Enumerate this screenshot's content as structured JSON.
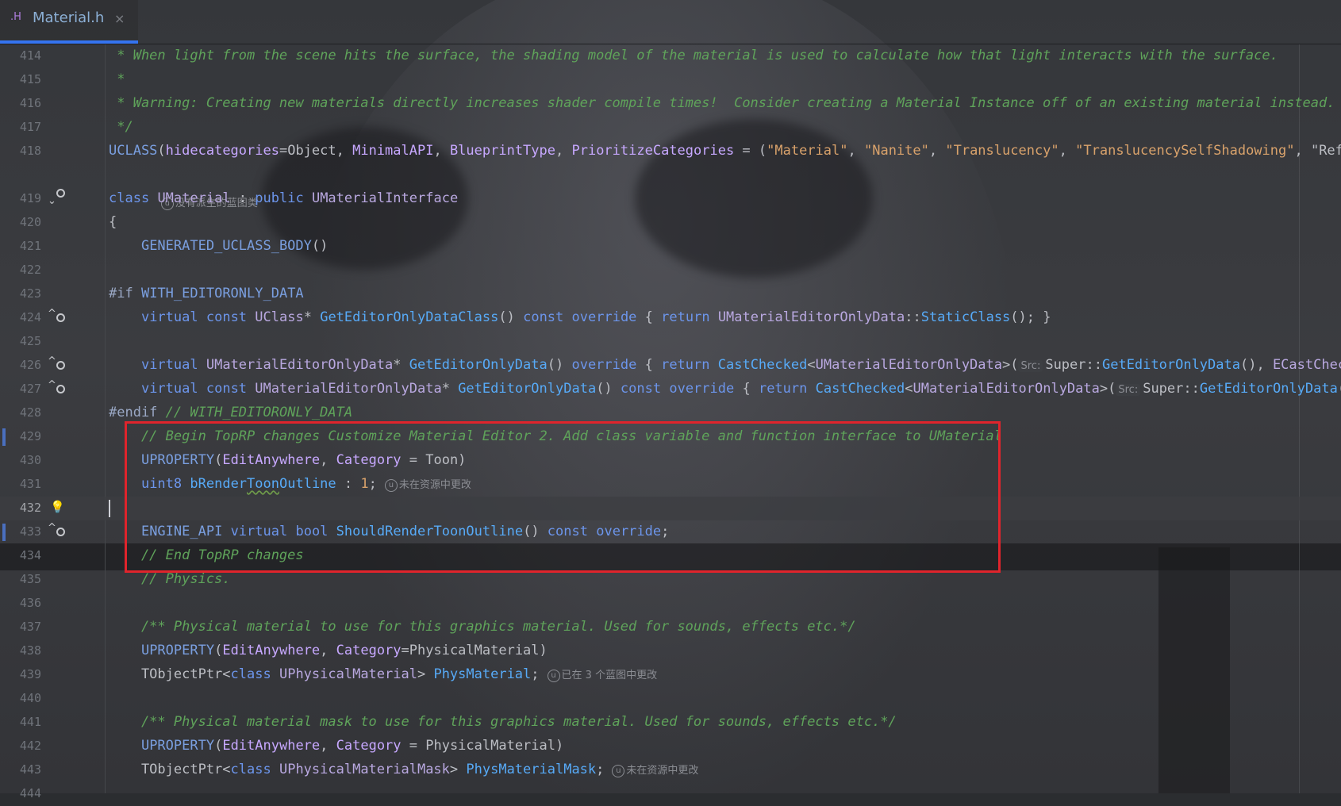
{
  "tab": {
    "icon": ".H",
    "filename": "Material.h",
    "close": "×"
  },
  "lines": [
    {
      "n": "414",
      "code": " * When light from the scene hits the surface, the shading model of the material is used to calculate how that light interacts with the surface."
    },
    {
      "n": "415",
      "code": " *"
    },
    {
      "n": "416",
      "code": " * Warning: Creating new materials directly increases shader compile times!  Consider creating a Material Instance off of an existing material instead."
    },
    {
      "n": "417",
      "code": " */"
    },
    {
      "n": "418",
      "code": "UCLASS(hidecategories=Object, MinimalAPI, BlueprintType, PrioritizeCategories = (\"Material\", \"Nanite\", \"Translucency\", \"TranslucencySelfShadowing\", \"Refract"
    },
    {
      "n": "",
      "hint": "没有派生的蓝图类"
    },
    {
      "n": "419",
      "code": "class UMaterial : public UMaterialInterface"
    },
    {
      "n": "420",
      "code": "{"
    },
    {
      "n": "421",
      "code": "    GENERATED_UCLASS_BODY()"
    },
    {
      "n": "422",
      "code": ""
    },
    {
      "n": "423",
      "code": "#if WITH_EDITORONLY_DATA"
    },
    {
      "n": "424",
      "code": "    virtual const UClass* GetEditorOnlyDataClass() const override { return UMaterialEditorOnlyData::StaticClass(); }"
    },
    {
      "n": "425",
      "code": ""
    },
    {
      "n": "426",
      "code": "    virtual UMaterialEditorOnlyData* GetEditorOnlyData() override { return CastChecked<UMaterialEditorOnlyData>(Src:Super::GetEditorOnlyData(), ECastChecked"
    },
    {
      "n": "427",
      "code": "    virtual const UMaterialEditorOnlyData* GetEditorOnlyData() const override { return CastChecked<UMaterialEditorOnlyData>(Src:Super::GetEditorOnlyData(),"
    },
    {
      "n": "428",
      "code": "#endif // WITH_EDITORONLY_DATA"
    },
    {
      "n": "429",
      "code": "    // Begin TopRP changes Customize Material Editor 2. Add class variable and function interface to UMaterial"
    },
    {
      "n": "430",
      "code": "    UPROPERTY(EditAnywhere, Category = Toon)"
    },
    {
      "n": "431",
      "code": "    uint8 bRenderToonOutline : 1;",
      "hint": "未在资源中更改"
    },
    {
      "n": "432",
      "code": ""
    },
    {
      "n": "433",
      "code": "    ENGINE_API virtual bool ShouldRenderToonOutline() const override;"
    },
    {
      "n": "434",
      "code": "    // End TopRP changes"
    },
    {
      "n": "435",
      "code": "    // Physics."
    },
    {
      "n": "436",
      "code": ""
    },
    {
      "n": "437",
      "code": "    /** Physical material to use for this graphics material. Used for sounds, effects etc.*/"
    },
    {
      "n": "438",
      "code": "    UPROPERTY(EditAnywhere, Category=PhysicalMaterial)"
    },
    {
      "n": "439",
      "code": "    TObjectPtr<class UPhysicalMaterial> PhysMaterial;",
      "hint": "已在 3 个蓝图中更改"
    },
    {
      "n": "440",
      "code": ""
    },
    {
      "n": "441",
      "code": "    /** Physical material mask to use for this graphics material. Used for sounds, effects etc.*/"
    },
    {
      "n": "442",
      "code": "    UPROPERTY(EditAnywhere, Category = PhysicalMaterial)"
    },
    {
      "n": "443",
      "code": "    TObjectPtr<class UPhysicalMaterialMask> PhysMaterialMask;",
      "hint": "未在资源中更改"
    },
    {
      "n": "444",
      "code": ""
    }
  ],
  "colors": {
    "accent": "#3574f0",
    "highlight_box": "#e0242c",
    "comment": "#5fa35a",
    "keyword": "#6c95eb"
  }
}
